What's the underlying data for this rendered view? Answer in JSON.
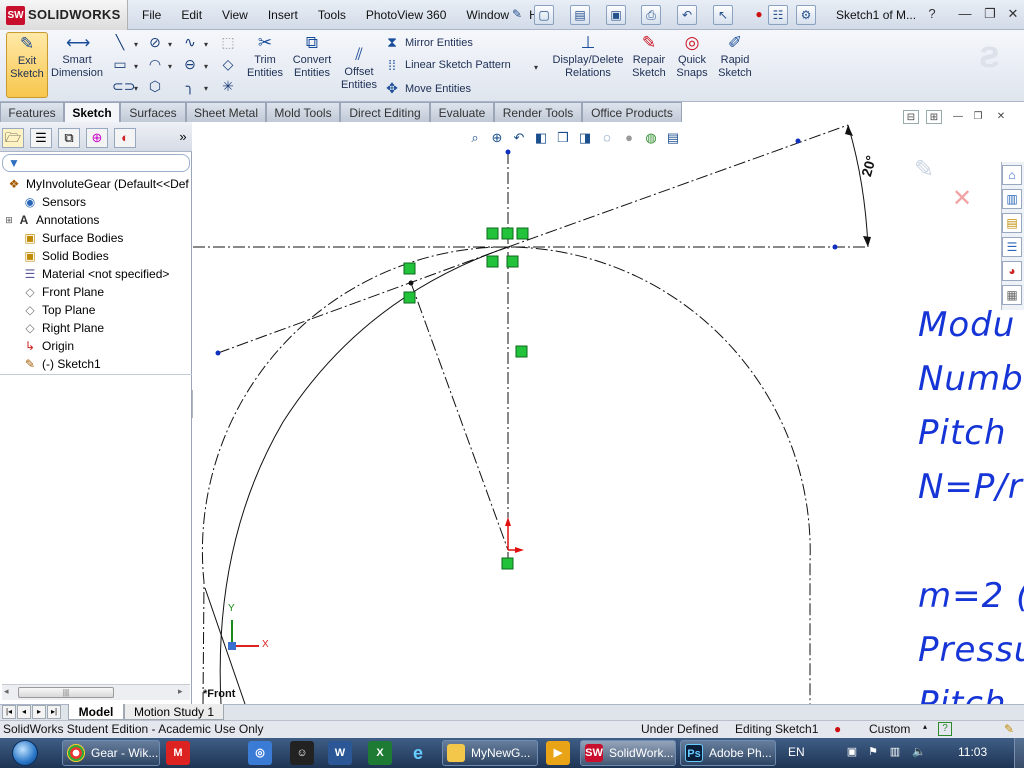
{
  "app": {
    "logo_badge": "SW",
    "name": "SOLIDWORKS",
    "doc_title": "Sketch1 of M..."
  },
  "menu": [
    "File",
    "Edit",
    "View",
    "Insert",
    "Tools",
    "PhotoView 360",
    "Window",
    "Help"
  ],
  "commands": {
    "exit_sketch": "Exit Sketch",
    "smart_dimension": "Smart Dimension",
    "trim_entities": "Trim Entities",
    "convert_entities": "Convert Entities",
    "offset_entities": "Offset Entities",
    "mirror_entities": "Mirror Entities",
    "linear_sketch_pattern": "Linear Sketch Pattern",
    "move_entities": "Move Entities",
    "display_delete_relations": "Display/Delete Relations",
    "repair_sketch": "Repair Sketch",
    "quick_snaps": "Quick Snaps",
    "rapid_sketch": "Rapid Sketch"
  },
  "tabs": [
    "Features",
    "Sketch",
    "Surfaces",
    "Sheet Metal",
    "Mold Tools",
    "Direct Editing",
    "Evaluate",
    "Render Tools",
    "Office Products"
  ],
  "active_tab": "Sketch",
  "tree": {
    "root": "MyInvoluteGear  (Default<<Def",
    "items": [
      "Sensors",
      "Annotations",
      "Surface Bodies",
      "Solid Bodies",
      "Material <not specified>",
      "Front Plane",
      "Top Plane",
      "Right Plane",
      "Origin",
      "(-) Sketch1"
    ]
  },
  "graphics": {
    "dimension_label": "20°",
    "view_label": "*Front",
    "axis_y": "Y",
    "axis_x": "X",
    "note_lines": [
      "Modu",
      "Numb",
      "Pitch",
      "N=P/r",
      "m=2 (",
      "Pressu",
      "Pitch"
    ]
  },
  "bottom_tabs": [
    "Model",
    "Motion Study 1"
  ],
  "status": {
    "edition": "SolidWorks Student Edition - Academic Use Only",
    "definition": "Under Defined",
    "editing": "Editing Sketch1",
    "units": "Custom"
  },
  "taskbar": {
    "items": [
      {
        "label": "Gear - Wik...",
        "icon": "chrome-icon"
      },
      {
        "label": "MyNewG...",
        "icon": "folder-icon"
      },
      {
        "label": "SolidWork...",
        "icon": "solidworks-icon"
      },
      {
        "label": "Adobe Ph...",
        "icon": "photoshop-icon"
      }
    ],
    "pinned_badges": {
      "word": "W",
      "excel": "X"
    },
    "language": "EN",
    "clock": "11:03"
  },
  "colors": {
    "note_blue": "#1635d6",
    "relation_green": "#22c33a",
    "point_blue": "#1030c0",
    "origin_red": "#e01010"
  }
}
